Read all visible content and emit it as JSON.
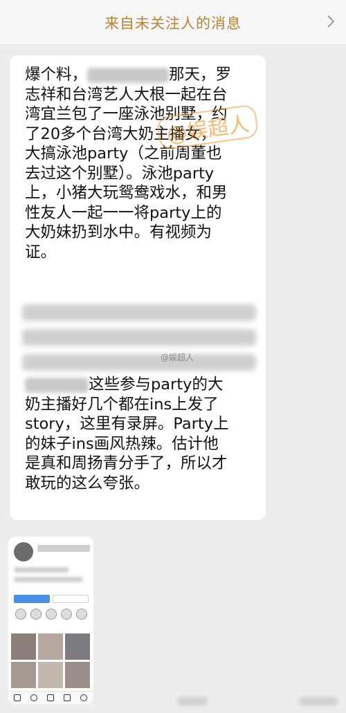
{
  "header": {
    "title": "来自未关注人的消息"
  },
  "message": {
    "para1": [
      "爆个料，",
      "那天，罗",
      "志祥和台湾艺人大根一起在台",
      "湾宜兰包了一座泳池别墅，约",
      "了20多个台湾大奶主播女，",
      "大搞泳池party（之前周董也",
      "去过这个别墅）。泳池party",
      "上，小猪大玩鸳鸯戏水，和男",
      "性友人一起一一将party上的",
      "大奶妹扔到水中。有视频为",
      "证。"
    ],
    "para2": [
      "这些参与party的大",
      "奶主播好几个都在ins上发了",
      "story，这里有录屏。Party上",
      "的妹子ins画风热辣。估计他",
      "是真和周扬青分手了，所以才",
      "敢玩的这么夸张。"
    ]
  },
  "watermarks": {
    "big": "@娱超人",
    "mid": "@娱超人"
  },
  "colors": {
    "header_title": "#b5852f",
    "page_bg": "#ededed",
    "bubble_bg": "#ffffff",
    "follow_button": "#4a90e2"
  },
  "icons": {
    "header_chevron": "chevron-right-icon"
  }
}
